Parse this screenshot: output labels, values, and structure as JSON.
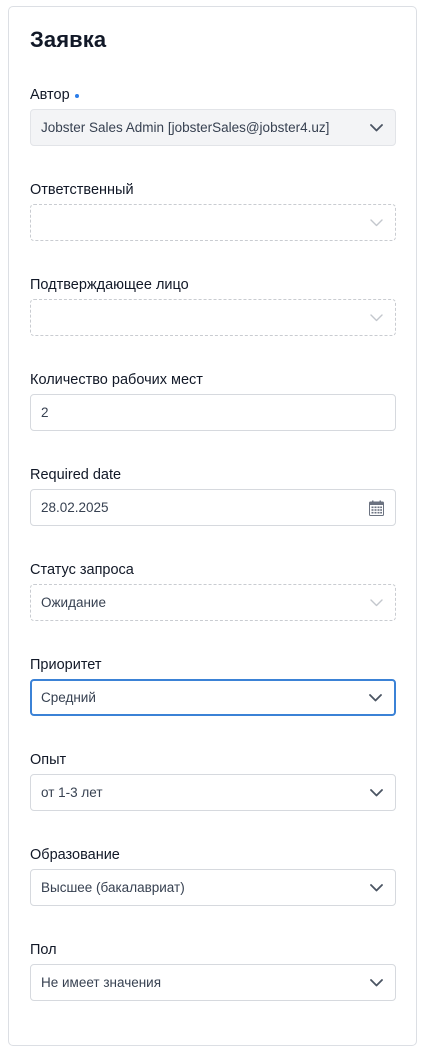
{
  "form": {
    "title": "Заявка",
    "fields": {
      "author": {
        "label": "Автор",
        "value": "Jobster Sales Admin [jobsterSales@jobster4.uz]",
        "required": true
      },
      "responsible": {
        "label": "Ответственный",
        "value": ""
      },
      "approver": {
        "label": "Подтверждающее лицо",
        "value": ""
      },
      "workplaces": {
        "label": "Количество рабочих мест",
        "value": "2"
      },
      "required_date": {
        "label": "Required date",
        "value": "28.02.2025"
      },
      "status": {
        "label": "Статус запроса",
        "value": "Ожидание"
      },
      "priority": {
        "label": "Приоритет",
        "value": "Средний"
      },
      "experience": {
        "label": "Опыт",
        "value": "от 1-3 лет"
      },
      "education": {
        "label": "Образование",
        "value": "Высшее (бакалавриат)"
      },
      "gender": {
        "label": "Пол",
        "value": "Не имеет значения"
      }
    }
  },
  "icons": {
    "dropdown": "chevron-down-icon",
    "date": "calendar-icon"
  },
  "colors": {
    "accent": "#3b82d6",
    "required_dot": "#2b7de9",
    "chevron": "#4b5563",
    "chevron_muted": "#c3c7cd"
  }
}
